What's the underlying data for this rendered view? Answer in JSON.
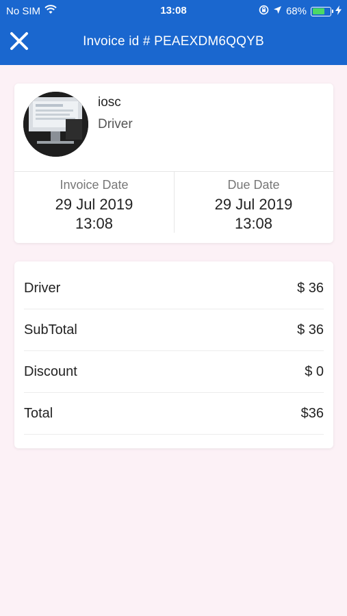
{
  "status_bar": {
    "carrier": "No SIM",
    "time": "13:08",
    "battery_percent": "68%",
    "battery_level": 0.68,
    "icons": [
      "wifi-icon",
      "orientation-lock-icon",
      "location-icon",
      "battery-icon",
      "charging-icon"
    ]
  },
  "header": {
    "title": "Invoice id # PEAEXDM6QQYB",
    "close_icon": "close-icon",
    "background_color": "#1a67cf"
  },
  "profile": {
    "name": "iosc",
    "role": "Driver"
  },
  "dates": {
    "invoice_label": "Invoice Date",
    "invoice_date": "29 Jul 2019",
    "invoice_time": "13:08",
    "due_label": "Due Date",
    "due_date": "29 Jul 2019",
    "due_time": "13:08"
  },
  "totals": [
    {
      "label": "Driver",
      "value": "$ 36"
    },
    {
      "label": "SubTotal",
      "value": "$ 36"
    },
    {
      "label": "Discount",
      "value": "$ 0"
    },
    {
      "label": "Total",
      "value": "$36"
    }
  ]
}
